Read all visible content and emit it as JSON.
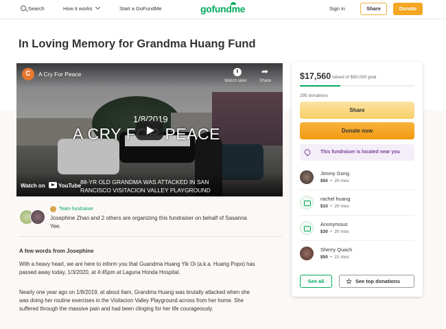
{
  "header": {
    "search_label": "Search",
    "how_it_works_label": "How it works",
    "start_label": "Start a GoFundMe",
    "logo_text": "gofundme",
    "sign_in_label": "Sign in",
    "share_label": "Share",
    "donate_label": "Donate"
  },
  "page_title": "In Loving Memory for Grandma Huang Fund",
  "video": {
    "channel_initial": "C",
    "title": "A Cry For Peace",
    "watch_later_label": "Watch later",
    "share_label": "Share",
    "overlay_date": "1/8/2019",
    "overlay_title": "A CRY FOR PEACE",
    "watch_on_label": "Watch on",
    "youtube_label": "YouTube",
    "caption_line1": "88-YR OLD GRANDMA WAS ATTACKED IN SAN",
    "caption_line2": "RANCISCO VISITACION VALLEY PLAYGROUND"
  },
  "organizer": {
    "team_label": "Team fundraiser",
    "text": "Josephine Zhao and 2 others are organizing this fundraiser on behalf of Sasanna Yee."
  },
  "story": {
    "heading": "A few words from Josephine",
    "paragraph1": "With a heavy heart, we are here to inform you that Guandma Huang Yik Oi (a.k.a. Huang Popo) has passed away today, 1/3/2020, at 4:45pm at Laguna Honda Hospital.",
    "paragraph2": "Nearly one year ago on 1/8/2019, at about 6am, Grandma Huang was brutally attacked when she was doing her routine exercises in the Visitacion Valley Playground across from her home. She suffered through the massive pain and had been clinging for her life courageously."
  },
  "donation_card": {
    "raised": "$17,560",
    "goal_text": "raised of $50,000 goal",
    "progress_fraction": 0.3512,
    "donation_count": "295 donations",
    "share_label": "Share",
    "donate_label": "Donate now",
    "location_text": "This fundraiser is located near you",
    "donors": [
      {
        "name": "Jimmy Gong",
        "amount": "$50",
        "time": "20 mos",
        "avatar": "photo"
      },
      {
        "name": "rachel huang",
        "amount": "$10",
        "time": "20 mos",
        "avatar": "donation-icon"
      },
      {
        "name": "Anonymous",
        "amount": "$30",
        "time": "20 mos",
        "avatar": "donation-icon"
      },
      {
        "name": "Sherry Quach",
        "amount": "$50",
        "time": "21 mos",
        "avatar": "photo"
      }
    ],
    "see_all_label": "See all",
    "see_top_label": "See top donations"
  },
  "colors": {
    "brand_green": "#02a95c",
    "donate_orange": "#f5a623",
    "location_purple": "#7a3e9d"
  }
}
